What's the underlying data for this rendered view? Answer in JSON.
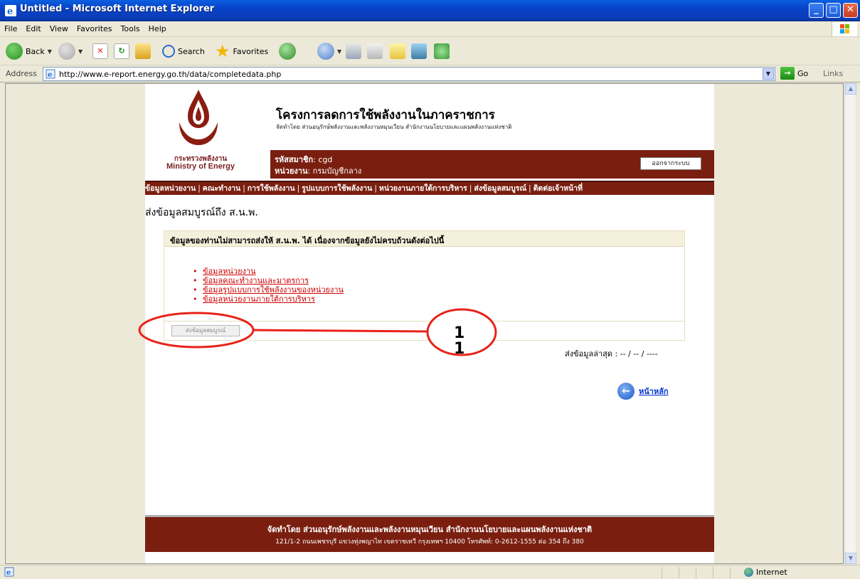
{
  "window": {
    "title": "Untitled - Microsoft Internet Explorer",
    "buttons": {
      "minimize": "_",
      "maximize": "□",
      "close": "✕"
    }
  },
  "menu": [
    "File",
    "Edit",
    "View",
    "Favorites",
    "Tools",
    "Help"
  ],
  "toolbar": {
    "back_label": "Back",
    "search_label": "Search",
    "favorites_label": "Favorites"
  },
  "address": {
    "label": "Address",
    "url": "http://www.e-report.energy.go.th/data/completedata.php",
    "go_label": "Go",
    "links_label": "Links"
  },
  "site": {
    "org_th": "กระทรวงพลังงาน",
    "org_en": "Ministry of Energy",
    "title": "โครงการลดการใช้พลังงานในภาคราชการ",
    "subtitle": "จัดทำโดย ส่วนอนุรักษ์พลังงานและพลังงานหมุนเวียน สำนักงานนโยบายและแผนพลังงานแห่งชาติ",
    "member_label": "รหัสสมาชิก",
    "member_value": ": cgd",
    "unit_label": "หน่วยงาน",
    "unit_value": ": กรมบัญชีกลาง",
    "logout": "ออกจากระบบ"
  },
  "nav": [
    "ข้อมูลหน่วยงาน",
    "คณะทำงาน",
    "การใช้พลังงาน",
    "รูปแบบการใช้พลังงาน",
    "หน่วยงานภายใต้การบริหาร",
    "ส่งข้อมูลสมบูรณ์",
    "ติดต่อเจ้าหน้าที่"
  ],
  "page": {
    "heading": "ส่งข้อมูลสมบูรณ์ถึง ส.น.พ.",
    "notice": "ข้อมูลของท่านไม่สามารถส่งให้ ส.น.พ. ได้ เนื่องจากข้อมูลยังไม่ครบถ้วนดังต่อไปนี้",
    "missing_items": [
      "ข้อมูลหน่วยงาน",
      "ข้อมูลคณะทำงานและมาตรการ",
      "ข้อมูลรูปแบบการใช้พลังงานของหน่วยงาน",
      "ข้อมูลหน่วยงานภายใต้การบริหาร"
    ],
    "send_button": "ส่งข้อมูลสมบูรณ์",
    "last_send": "ส่งข้อมูลล่าสุด : -- / -- / ----",
    "home_link": "หน้าหลัก"
  },
  "footer": {
    "line1": "จัดทำโดย ส่วนอนุรักษ์พลังงานและพลังงานหมุนเวียน สำนักงานนโยบายและแผนพลังงานแห่งชาติ",
    "line2": "121/1-2 ถนนเพชรบุรี แขวงทุ่งพญาไท เขตราชเทวี กรุงเทพฯ 10400  โทรศัพท์: 0-2612-1555 ต่อ 354 ถึง 380"
  },
  "annotation": {
    "number_top": "1",
    "number_bottom": "1",
    "color": "#e8231a"
  },
  "status": {
    "zone": "Internet"
  }
}
